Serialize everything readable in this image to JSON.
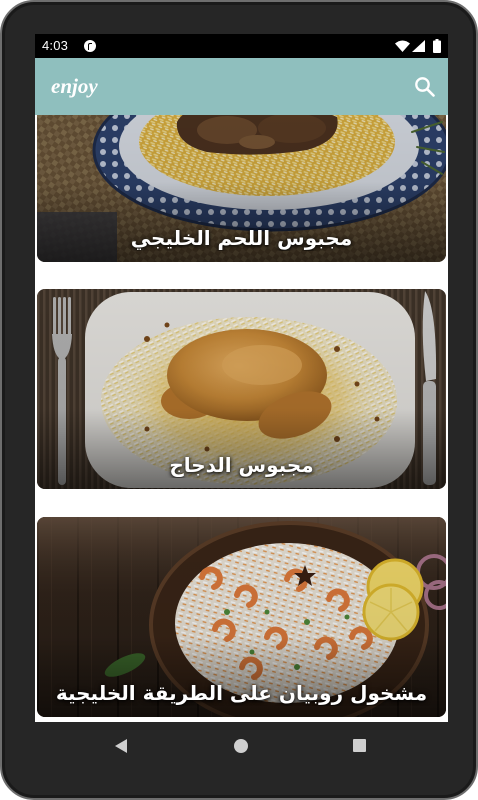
{
  "status_bar": {
    "time": "4:03",
    "icons": [
      "notification-icon",
      "wifi-icon",
      "signal-icon",
      "battery-icon"
    ]
  },
  "app_bar": {
    "title": "enjoy",
    "action_icon": "search-icon"
  },
  "recipes": [
    {
      "title": "مجبوس اللحم الخليجي"
    },
    {
      "title": "مجبوس الدجاج"
    },
    {
      "title": "مشخول روبيان على الطريقة الخليجية"
    }
  ],
  "nav_bar": {
    "icons": [
      "back-icon",
      "home-icon",
      "recents-icon"
    ]
  },
  "colors": {
    "app_bar": "#8fbfbe",
    "status_bar": "#000000",
    "device_frame": "#262626",
    "card_title": "#ffffff",
    "nav_icons": "#cfcfcf"
  }
}
